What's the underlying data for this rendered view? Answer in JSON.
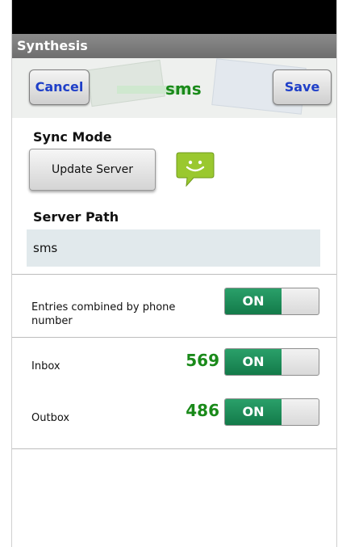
{
  "appbar": {
    "title": "Synthesis"
  },
  "header": {
    "cancel_label": "Cancel",
    "title": "sms",
    "save_label": "Save"
  },
  "sync": {
    "label": "Sync Mode",
    "button_label": "Update Server"
  },
  "server_path": {
    "label": "Server Path",
    "value": "sms"
  },
  "entries_combined": {
    "label": "Entries combined by phone number",
    "toggle_label": "ON"
  },
  "inbox": {
    "label": "Inbox",
    "count": "569",
    "toggle_label": "ON"
  },
  "outbox": {
    "label": "Outbox",
    "count": "486",
    "toggle_label": "ON"
  },
  "colors": {
    "accent_green": "#1a8a1a",
    "button_text_blue": "#1f3fc8",
    "toggle_on": "#168a55"
  },
  "icons": {
    "sms": "sms-smiley-icon"
  }
}
